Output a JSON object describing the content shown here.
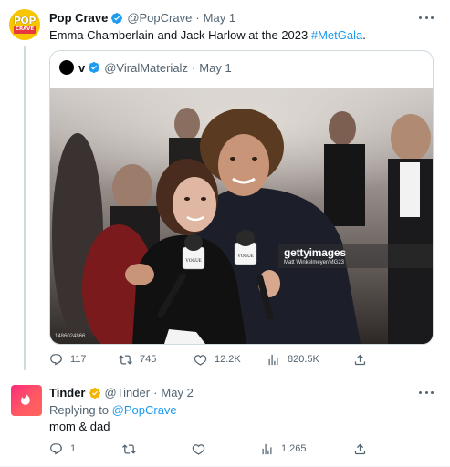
{
  "colors": {
    "accent": "#1d9bf0",
    "verified_gold": "#f4b400",
    "text": "#0f1419",
    "muted": "#536471",
    "popcrave_yellow": "#f7c600",
    "tinder_pink": "#fd297b"
  },
  "tweet": {
    "author_name": "Pop Crave",
    "handle": "@PopCrave",
    "date": "May 1",
    "avatar_logo": {
      "top": "POP",
      "bottom": "CRAVE"
    },
    "text_before": "Emma Chamberlain and Jack Harlow at the 2023 ",
    "hashtag": "#MetGala",
    "text_after": ".",
    "quote": {
      "author_name": "v",
      "handle": "@ViralMaterialz",
      "date": "May 1",
      "photo": {
        "watermark": "gettyimages",
        "credit": "Matt Winkelmeyer/MG23",
        "id": "1486024866",
        "mic_flag_text": "VOGUE"
      }
    },
    "stats": {
      "replies": "117",
      "retweets": "745",
      "likes": "12.2K",
      "views": "820.5K"
    },
    "icons": {
      "reply": "reply-icon",
      "retweet": "retweet-icon",
      "like": "heart-icon",
      "views": "views-icon",
      "share": "share-icon",
      "more": "more-icon",
      "verified": "verified-badge-icon"
    }
  },
  "reply": {
    "author_name": "Tinder",
    "handle": "@Tinder",
    "date": "May 2",
    "replying_to_label": "Replying to ",
    "replying_to_handle": "@PopCrave",
    "text": "mom & dad",
    "stats": {
      "replies": "1",
      "retweets": "",
      "likes": "",
      "views": "1,265"
    }
  }
}
